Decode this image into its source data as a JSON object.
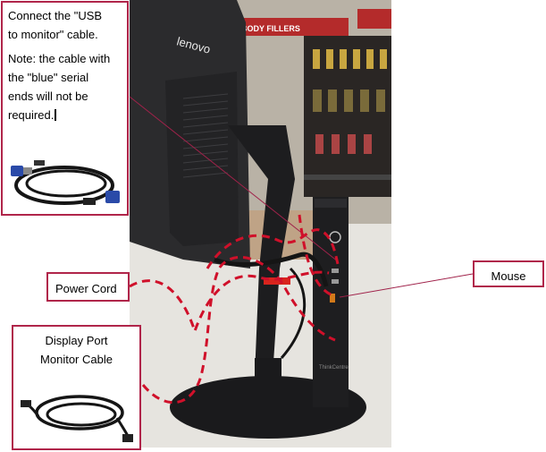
{
  "callouts": {
    "usb_cable": {
      "line1": "Connect the \"USB",
      "line2": "to monitor\"  cable.",
      "note1": "Note: the  cable with",
      "note2": "the  \"blue\"  serial",
      "note3": "ends will  not  be",
      "note4": "required."
    },
    "power_cord": "Power Cord",
    "mouse": "Mouse",
    "display_port": {
      "line1": "Display Port",
      "line2": "Monitor   Cable"
    }
  },
  "photo": {
    "store_sign": "BODY FILLERS",
    "monitor_brand": "lenovo",
    "pc_brand": "ThinkCentre"
  },
  "colors": {
    "callout_border": "#b0254a",
    "leader_line": "#a0224a",
    "dashed_route": "#d0102a",
    "cable_blue": "#2a4aa8",
    "cable_black": "#151515"
  }
}
